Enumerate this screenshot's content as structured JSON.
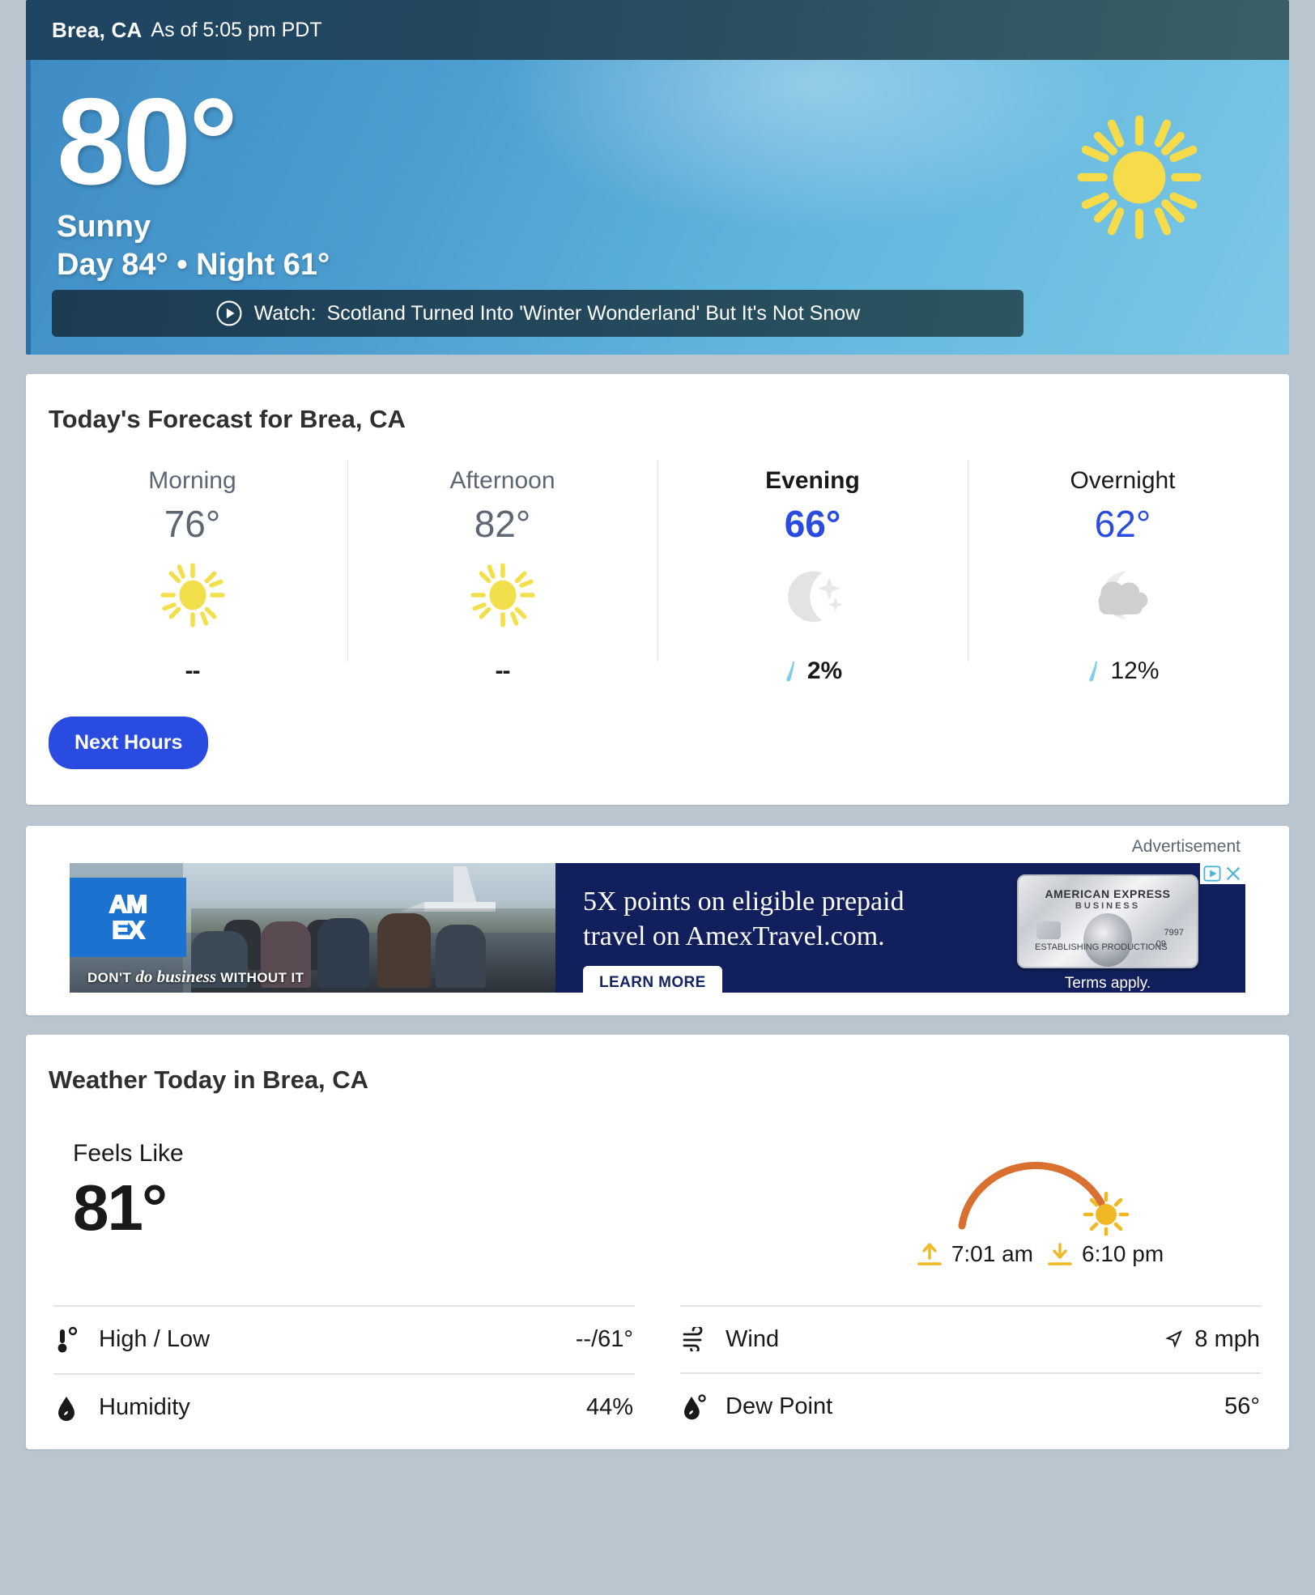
{
  "hero": {
    "location": "Brea, CA",
    "as_of": "As of 5:05 pm PDT",
    "temperature": "80°",
    "condition": "Sunny",
    "day_night": "Day 84° • Night 61°",
    "icon": "sun-icon",
    "watch": {
      "label": "Watch:",
      "headline": "Scotland Turned Into 'Winter Wonderland' But It's Not Snow",
      "icon": "play-circle-icon"
    }
  },
  "forecast": {
    "title": "Today's Forecast for Brea, CA",
    "periods": [
      {
        "label": "Morning",
        "temp": "76°",
        "icon": "sun-icon",
        "precip": "--",
        "highlight": false,
        "style": "gray"
      },
      {
        "label": "Afternoon",
        "temp": "82°",
        "icon": "sun-icon",
        "precip": "--",
        "highlight": false,
        "style": "gray"
      },
      {
        "label": "Evening",
        "temp": "66°",
        "icon": "moon-stars-icon",
        "precip": "2%",
        "highlight": true,
        "style": "blue"
      },
      {
        "label": "Overnight",
        "temp": "62°",
        "icon": "cloud-moon-icon",
        "precip": "12%",
        "highlight": false,
        "style": "blue-plain"
      }
    ],
    "next_hours_label": "Next Hours"
  },
  "ad": {
    "label": "Advertisement",
    "brand_line1": "AM",
    "brand_line2": "EX",
    "tagline_pre": "DON'T ",
    "tagline_em": "do business",
    "tagline_post": " WITHOUT IT",
    "headline": "5X points on eligible prepaid travel on AmexTravel.com.",
    "cta": "LEARN MORE",
    "card_name": "AMERICAN EXPRESS",
    "card_type": "BUSINESS",
    "card_number_tail": "7997",
    "card_holder": "ESTABLISHING PRODUCTIONS",
    "card_exp": "09",
    "terms": "Terms apply.",
    "adchoices_icon": "adchoices-icon",
    "close_icon": "close-icon"
  },
  "weather_today": {
    "title": "Weather Today in Brea, CA",
    "feels_like_label": "Feels Like",
    "feels_like_value": "81°",
    "sunrise_time": "7:01 am",
    "sunset_time": "6:10 pm",
    "sunrise_icon": "sunrise-arrow-icon",
    "sunset_icon": "sunset-arrow-icon",
    "arc_color": "#d9702f",
    "sun_color": "#f0b823",
    "left_items": [
      {
        "icon": "thermometer-icon",
        "name": "High / Low",
        "value": "--/61°"
      },
      {
        "icon": "humidity-drop-icon",
        "name": "Humidity",
        "value": "44%"
      }
    ],
    "right_items": [
      {
        "icon": "wind-icon",
        "name": "Wind",
        "value": "8 mph",
        "value_icon": "wind-direction-arrow-icon"
      },
      {
        "icon": "dewpoint-drop-icon",
        "name": "Dew Point",
        "value": "56°",
        "value_icon": ""
      }
    ]
  },
  "colors": {
    "accent_blue": "#2a4be0",
    "gray_text": "#5d6673",
    "dark_text": "#19191b",
    "sun_yellow": "#f2df4c"
  }
}
